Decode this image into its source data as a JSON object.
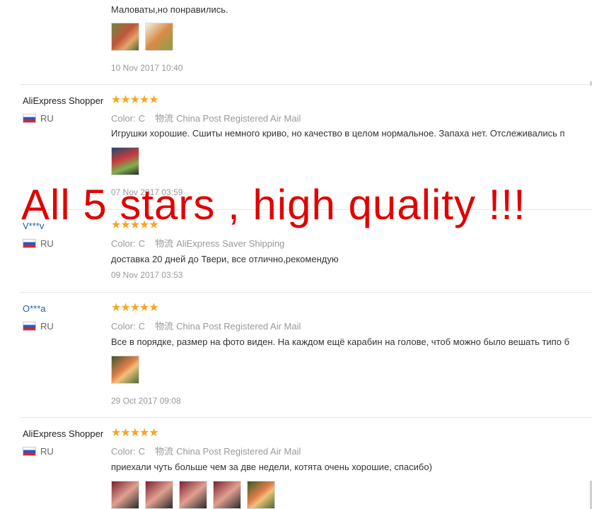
{
  "reviews": [
    {
      "text": "Маловаты,но понравились.",
      "date": "10 Nov 2017 10:40"
    },
    {
      "user": "AliExpress Shopper",
      "country": "RU",
      "rating": 5,
      "color_label": "Color:",
      "color_value": "C",
      "ship_label": "物流",
      "ship_value": "China Post Registered Air Mail",
      "text": "Игрушки хорошие. Сшиты немного криво, но качество в целом нормальное. Запаха нет. Отслеживались п",
      "date": "07 Nov 2017 03:59"
    },
    {
      "user": "V***v",
      "country": "RU",
      "rating": 5,
      "color_label": "Color:",
      "color_value": "C",
      "ship_label": "物流",
      "ship_value": "AliExpress Saver Shipping",
      "text": "доставка 20 дней до Твери, все отлично,рекомендую",
      "date": "09 Nov 2017 03:53"
    },
    {
      "user": "O***a",
      "country": "RU",
      "rating": 5,
      "color_label": "Color:",
      "color_value": "C",
      "ship_label": "物流",
      "ship_value": "China Post Registered Air Mail",
      "text": "Все в порядке, размер на фото виден. На каждом ещё карабин на голове, чтоб можно было вешать типо б",
      "date": "29 Oct 2017 09:08"
    },
    {
      "user": "AliExpress Shopper",
      "country": "RU",
      "rating": 5,
      "color_label": "Color:",
      "color_value": "C",
      "ship_label": "物流",
      "ship_value": "China Post Registered Air Mail",
      "text": "приехали чуть больше чем за две недели, котята очень хорошие, спасибо)"
    }
  ],
  "overlay_text": "All 5 stars , high quality !!!",
  "colors": {
    "star": "#f5a623",
    "overlay": "#e00000",
    "masked_user": "#1a5fb4"
  }
}
